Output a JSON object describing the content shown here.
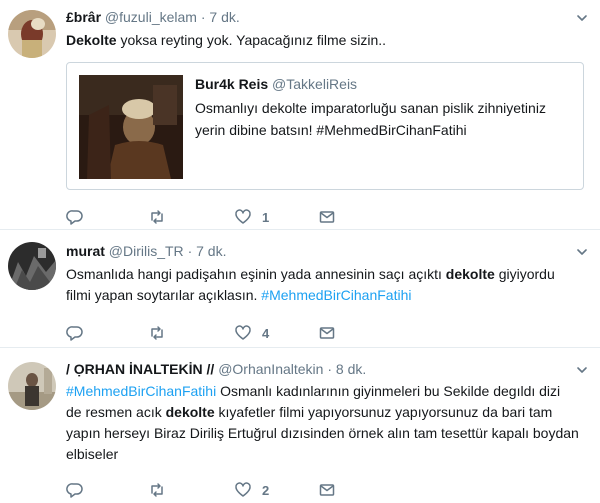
{
  "tweets": [
    {
      "name": "£brâr",
      "handle": "@fuzuli_kelam",
      "dot": "·",
      "time": "7 dk.",
      "text_kw": "Dekolte",
      "text_rest": " yoksa reyting yok. Yapacağınız filme sizin..",
      "quote": {
        "name": "Bur4k Reis",
        "handle": "@TakkeliReis",
        "line1": "Osmanlıyı dekolte imparatorluğu sanan pislik zihniyetiniz",
        "line2": "yerin dibine batsın! #MehmedBirCihanFatihi"
      },
      "actions": {
        "reply": "",
        "retweet": "",
        "like": "1",
        "dm": ""
      }
    },
    {
      "name": "murat",
      "handle": "@Dirilis_TR",
      "dot": "·",
      "time": "7 dk.",
      "line1_a": "Osmanlıda hangi padişahın eşinin yada annesinin saçı açıktı ",
      "line1_kw": "dekolte",
      "line1_b": " giyiyordu",
      "line2_a": "filmi yapan soytarılar açıklasın.  ",
      "line2_tag": "#MehmedBirCihanFatihi",
      "actions": {
        "reply": "",
        "retweet": "",
        "like": "4",
        "dm": ""
      }
    },
    {
      "name": "/ ỌRHAN İNALTEKİN //",
      "handle": "@OrhanInaltekin",
      "dot": "·",
      "time": "8 dk.",
      "line1_tag": "#MehmedBirCihanFatihi",
      "line1_rest": " Osmanlı kadınlarının giyinmeleri bu Sekilde degıldı dizi",
      "line2_a": "de resmen acık ",
      "line2_kw": "dekolte",
      "line2_b": " kıyafetler filmi yapıyorsunuz yapıyorsunuz da bari tam",
      "line3": "yapın herseyı Biraz Diriliş Ertuğrul dızısinden örnek alın tam tesettür kapalı boydan",
      "line4": "elbiseler",
      "actions": {
        "reply": "",
        "retweet": "",
        "like": "2",
        "dm": ""
      }
    }
  ],
  "colors": {
    "link": "#1da1f2",
    "muted": "#657786",
    "text": "#14171a",
    "border": "#e6ecf0"
  },
  "icons": [
    "reply-icon",
    "retweet-icon",
    "like-icon",
    "direct-message-icon",
    "chevron-down-icon"
  ]
}
